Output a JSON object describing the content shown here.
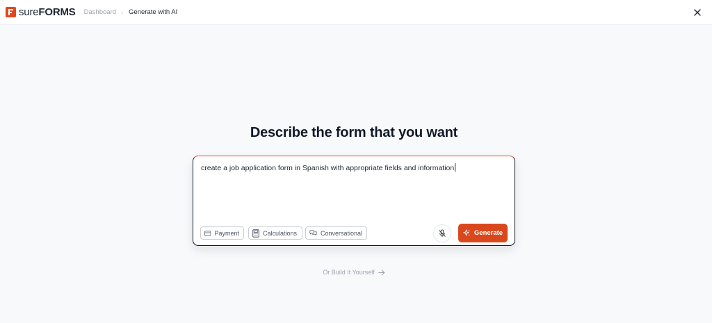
{
  "header": {
    "logo_text_regular": "sure",
    "logo_text_bold": "FORMS",
    "breadcrumb": {
      "link": "Dashboard",
      "separator": "›",
      "current": "Generate with AI"
    },
    "close_icon": "close-icon"
  },
  "main": {
    "heading": "Describe the form that you want",
    "prompt": {
      "value": "create a job application form in Spanish with appropriate fields and information"
    },
    "chips": [
      {
        "label": "Payment",
        "icon": "credit-card-icon"
      },
      {
        "label": "Calculations",
        "icon": "calculator-icon"
      },
      {
        "label": "Conversational",
        "icon": "chat-bubbles-icon"
      }
    ],
    "mic_icon": "microphone-off-icon",
    "generate_label": "Generate",
    "generate_icon": "sparkle-icon",
    "build_yourself_label": "Or Build It Yourself",
    "build_yourself_icon": "arrow-right-icon"
  },
  "colors": {
    "accent": "#d9481c",
    "background": "#f8f9fb",
    "text": "#111827",
    "muted": "#9ca3af"
  }
}
